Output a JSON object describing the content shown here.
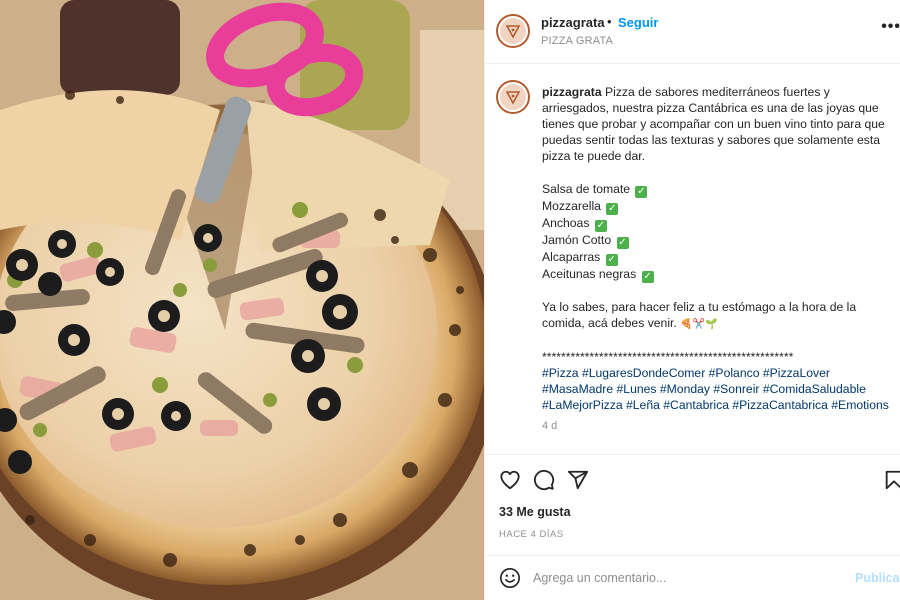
{
  "post": {
    "username": "pizzagrata",
    "follow_label": "Seguir",
    "separator": "•",
    "location": "PIZZA GRATA",
    "more_label": "•••"
  },
  "caption": {
    "username": "pizzagrata",
    "intro": " Pizza de sabores mediterráneos fuertes y arriesgados, nuestra pizza Cantábrica es una de las joyas que tienes que probar y acompañar con un buen vino tinto para que puedas sentir todas las texturas y sabores que solamente esta pizza te puede dar.",
    "ingredients": [
      "Salsa de tomate",
      "Mozzarella",
      "Anchoas",
      "Jamón Cotto",
      "Alcaparras",
      "Aceitunas negras"
    ],
    "check_emoji": "✓",
    "closing": "Ya lo sabes, para hacer feliz a tu estómago a la hora de la comida, acá debes venir. ",
    "closing_emoji": "🍕✂️🌱",
    "stars": "*****************************************************",
    "hashtags": "#Pizza #LugaresDondeComer #Polanco #PizzaLover #MasaMadre #Lunes #Monday #Sonreir #ComidaSaludable #LaMejorPizza #Leña #Cantabrica #PizzaCantabrica #Emotions",
    "age": "4 d"
  },
  "actions": {
    "likes": "33 Me gusta",
    "timestamp": "HACE 4 DÍAS",
    "icons": [
      "heart-icon",
      "comment-icon",
      "share-icon",
      "bookmark-icon"
    ]
  },
  "comment": {
    "placeholder": "Agrega un comentario...",
    "publish_label": "Publicar"
  },
  "colors": {
    "link_blue": "#0095f6",
    "hashtag_blue": "#00376b",
    "publish_disabled": "#b2dffc",
    "avatar_ring": "#b25d2e"
  }
}
